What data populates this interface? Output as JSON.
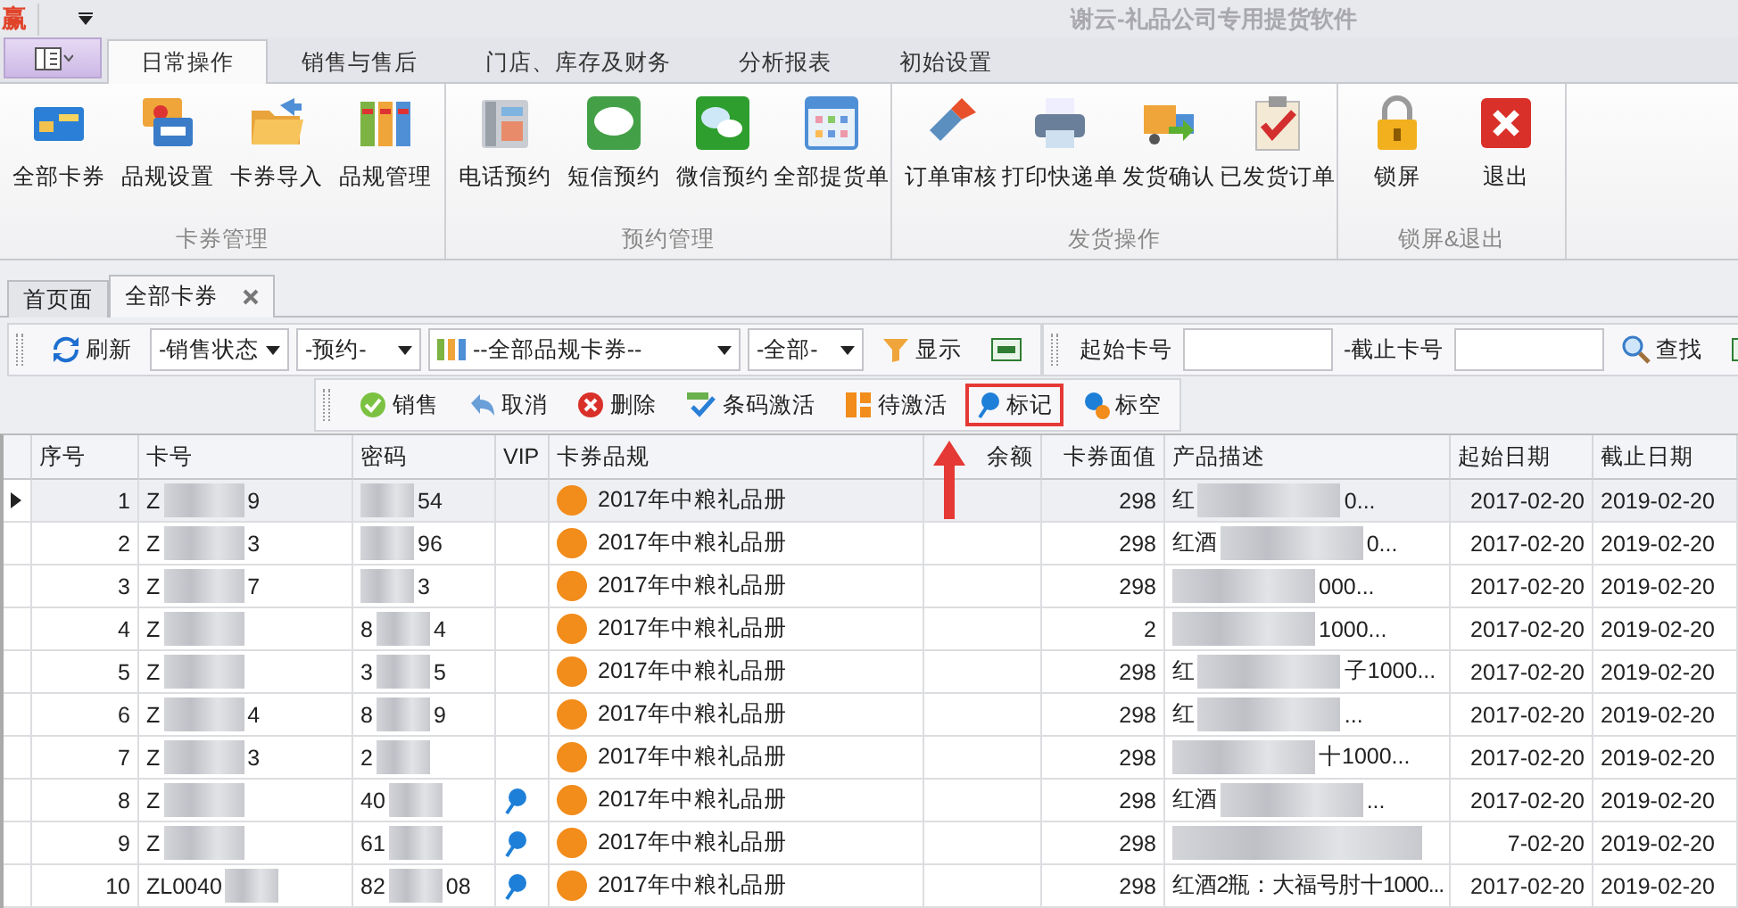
{
  "title_bar": {
    "logo": "赢",
    "title": "谢云-礼品公司专用提货软件"
  },
  "ribbon_tabs": [
    {
      "label": "日常操作",
      "selected": true
    },
    {
      "label": "销售与售后",
      "selected": false
    },
    {
      "label": "门店、库存及财务",
      "selected": false
    },
    {
      "label": "分析报表",
      "selected": false
    },
    {
      "label": "初始设置",
      "selected": false
    }
  ],
  "ribbon_groups": [
    {
      "label": "卡券管理",
      "items": [
        "全部卡券",
        "品规设置",
        "卡券导入",
        "品规管理"
      ]
    },
    {
      "label": "预约管理",
      "items": [
        "电话预约",
        "短信预约",
        "微信预约",
        "全部提货单"
      ]
    },
    {
      "label": "发货操作",
      "items": [
        "订单审核",
        "打印快递单",
        "发货确认",
        "已发货订单"
      ]
    },
    {
      "label": "锁屏&退出",
      "items": [
        "锁屏",
        "退出"
      ]
    }
  ],
  "document_tabs": [
    {
      "label": "首页面",
      "selected": false,
      "closable": false
    },
    {
      "label": "全部卡券",
      "selected": true,
      "closable": true
    }
  ],
  "filter_bar": {
    "refresh": "刷新",
    "dropdowns": [
      "-销售状态",
      "-预约-",
      "--全部品规卡券--",
      "-全部-"
    ],
    "show": "显示",
    "start_label": "起始卡号",
    "end_label": "-截止卡号",
    "find": "查找"
  },
  "action_bar": [
    {
      "label": "销售",
      "highlighted": false
    },
    {
      "label": "取消",
      "highlighted": false
    },
    {
      "label": "删除",
      "highlighted": false
    },
    {
      "label": "条码激活",
      "highlighted": false
    },
    {
      "label": "待激活",
      "highlighted": false
    },
    {
      "label": "标记",
      "highlighted": true
    },
    {
      "label": "标空",
      "highlighted": false
    }
  ],
  "table": {
    "columns": [
      "序号",
      "卡号",
      "密码",
      "VIP",
      "卡券品规",
      "余额",
      "卡券面值",
      "产品描述",
      "起始日期",
      "截止日期"
    ],
    "rows": [
      {
        "selected": true,
        "no": "1",
        "card": {
          "before": "Z",
          "after": "9"
        },
        "password": {
          "after": "54"
        },
        "vip": false,
        "spec": "2017年中粮礼品册",
        "value": "298",
        "desc": {
          "before": "红",
          "after": "0..."
        },
        "start": "2017-02-20",
        "end": "2019-02-20"
      },
      {
        "selected": false,
        "no": "2",
        "card": {
          "before": "Z",
          "after": "3"
        },
        "password": {
          "after": "96"
        },
        "vip": false,
        "spec": "2017年中粮礼品册",
        "value": "298",
        "desc": {
          "before": "红酒",
          "after": "0..."
        },
        "start": "2017-02-20",
        "end": "2019-02-20"
      },
      {
        "selected": false,
        "no": "3",
        "card": {
          "before": "Z",
          "after": "7"
        },
        "password": {
          "after": "3"
        },
        "vip": false,
        "spec": "2017年中粮礼品册",
        "value": "298",
        "desc": {
          "after": "000..."
        },
        "start": "2017-02-20",
        "end": "2019-02-20"
      },
      {
        "selected": false,
        "no": "4",
        "card": {
          "before": "Z"
        },
        "password": {
          "before": "8",
          "after": "4"
        },
        "vip": false,
        "spec": "2017年中粮礼品册",
        "value": "2",
        "desc": {
          "after": "1000..."
        },
        "start": "2017-02-20",
        "end": "2019-02-20"
      },
      {
        "selected": false,
        "no": "5",
        "card": {
          "before": "Z"
        },
        "password": {
          "before": "3",
          "after": "5"
        },
        "vip": false,
        "spec": "2017年中粮礼品册",
        "value": "298",
        "desc": {
          "before": "红",
          "after": "子1000..."
        },
        "start": "2017-02-20",
        "end": "2019-02-20"
      },
      {
        "selected": false,
        "no": "6",
        "card": {
          "before": "Z",
          "after": "4"
        },
        "password": {
          "before": "8",
          "after": "9"
        },
        "vip": false,
        "spec": "2017年中粮礼品册",
        "value": "298",
        "desc": {
          "before": "红",
          "after": "..."
        },
        "start": "2017-02-20",
        "end": "2019-02-20"
      },
      {
        "selected": false,
        "no": "7",
        "card": {
          "before": "Z",
          "after": "3"
        },
        "password": {
          "before": "2"
        },
        "vip": false,
        "spec": "2017年中粮礼品册",
        "value": "298",
        "desc": {
          "after": "十1000..."
        },
        "start": "2017-02-20",
        "end": "2019-02-20"
      },
      {
        "selected": false,
        "no": "8",
        "card": {
          "before": "Z"
        },
        "password": {
          "before": "40"
        },
        "vip": true,
        "spec": "2017年中粮礼品册",
        "value": "298",
        "desc": {
          "before": "红酒",
          "after": "..."
        },
        "start": "2017-02-20",
        "end": "2019-02-20"
      },
      {
        "selected": false,
        "no": "9",
        "card": {
          "before": "Z"
        },
        "password": {
          "before": "61"
        },
        "vip": true,
        "spec": "2017年中粮礼品册",
        "value": "298",
        "desc": {},
        "start": "7-02-20",
        "end": "2019-02-20"
      },
      {
        "selected": false,
        "no": "10",
        "card": {
          "before": "ZL0040"
        },
        "password": {
          "before": "82",
          "after": "08"
        },
        "vip": true,
        "spec": "2017年中粮礼品册",
        "value": "298",
        "desc": {
          "before": "红酒2瓶：大福号肘十1000..."
        },
        "start": "2017-02-20",
        "end": "2019-02-20"
      }
    ]
  }
}
